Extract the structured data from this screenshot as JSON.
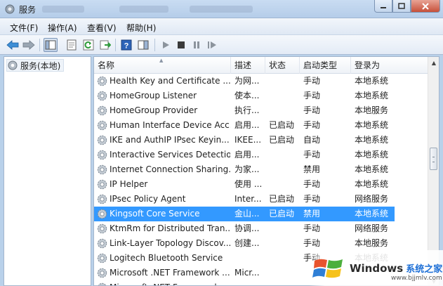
{
  "window": {
    "title": "服务"
  },
  "menu": [
    "文件(F)",
    "操作(A)",
    "查看(V)",
    "帮助(H)"
  ],
  "tree": {
    "root_label": "服务(本地)"
  },
  "columns": {
    "name": "名称",
    "description": "描述",
    "status": "状态",
    "startup": "启动类型",
    "logon": "登录为"
  },
  "services": [
    {
      "name": "Health Key and Certificate ...",
      "desc": "为网...",
      "status": "",
      "startup": "手动",
      "logon": "本地系统"
    },
    {
      "name": "HomeGroup Listener",
      "desc": "使本...",
      "status": "",
      "startup": "手动",
      "logon": "本地系统"
    },
    {
      "name": "HomeGroup Provider",
      "desc": "执行...",
      "status": "",
      "startup": "手动",
      "logon": "本地服务"
    },
    {
      "name": "Human Interface Device Acc...",
      "desc": "启用...",
      "status": "已启动",
      "startup": "手动",
      "logon": "本地系统"
    },
    {
      "name": "IKE and AuthIP IPsec Keyin...",
      "desc": "IKEE...",
      "status": "已启动",
      "startup": "自动",
      "logon": "本地系统"
    },
    {
      "name": "Interactive Services Detection",
      "desc": "启用...",
      "status": "",
      "startup": "手动",
      "logon": "本地系统"
    },
    {
      "name": "Internet Connection Sharing...",
      "desc": "为家...",
      "status": "",
      "startup": "禁用",
      "logon": "本地系统"
    },
    {
      "name": "IP Helper",
      "desc": "使用 ...",
      "status": "",
      "startup": "手动",
      "logon": "本地系统"
    },
    {
      "name": "IPsec Policy Agent",
      "desc": "Inter...",
      "status": "已启动",
      "startup": "手动",
      "logon": "网络服务"
    },
    {
      "name": "Kingsoft Core Service",
      "desc": "金山...",
      "status": "已启动",
      "startup": "禁用",
      "logon": "本地系统",
      "selected": true
    },
    {
      "name": "KtmRm for Distributed Tran...",
      "desc": "协调...",
      "status": "",
      "startup": "手动",
      "logon": "网络服务"
    },
    {
      "name": "Link-Layer Topology Discov...",
      "desc": "创建...",
      "status": "",
      "startup": "手动",
      "logon": "本地服务"
    },
    {
      "name": "Logitech Bluetooth Service",
      "desc": "",
      "status": "",
      "startup": "手动",
      "logon": "本地系统"
    },
    {
      "name": "Microsoft .NET Framework ...",
      "desc": "Micr...",
      "status": "",
      "startup": "",
      "logon": ""
    },
    {
      "name": "Microsoft .NET Framework ...",
      "desc": "",
      "status": "",
      "startup": "",
      "logon": ""
    }
  ],
  "watermark": {
    "brand": "Windows",
    "site": "系统之家",
    "url": "www.bjjmlv.com"
  },
  "colors": {
    "selection": "#3399ff",
    "titlebar": "#b9d1ea"
  }
}
